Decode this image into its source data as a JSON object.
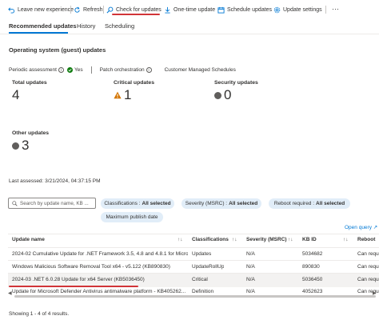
{
  "toolbar": {
    "leave": "Leave new experience",
    "refresh": "Refresh",
    "check": "Check for updates",
    "onetime": "One-time update",
    "schedule": "Schedule updates",
    "settings": "Update settings",
    "more": "···"
  },
  "tabs": [
    "Recommended updates",
    "History",
    "Scheduling"
  ],
  "section_title": "Operating system (guest) updates",
  "status": {
    "periodic_label": "Periodic assessment",
    "periodic_value": "Yes",
    "patch_label": "Patch orchestration",
    "customer": "Customer Managed Schedules"
  },
  "cards": {
    "total": {
      "label": "Total updates",
      "value": "4"
    },
    "critical": {
      "label": "Critical updates",
      "value": "1"
    },
    "security": {
      "label": "Security updates",
      "value": "0"
    },
    "other": {
      "label": "Other updates",
      "value": "3"
    }
  },
  "last_assessed": "Last assessed: 3/21/2024, 04:37:15 PM",
  "search": {
    "placeholder": "Search by update name, KB ..."
  },
  "filters": [
    {
      "label": "Classifications :",
      "value": "All selected"
    },
    {
      "label": "Severity (MSRC) :",
      "value": "All selected"
    },
    {
      "label": "Reboot required :",
      "value": "All selected"
    },
    {
      "label": "Maximum publish date",
      "value": ""
    }
  ],
  "open_query": "Open query",
  "table": {
    "headers": [
      "Update name",
      "Classifications",
      "Severity (MSRC)",
      "KB ID",
      "Reboot"
    ],
    "rows": [
      [
        "2024-02 Cumulative Update for .NET Framework 3.5, 4.8 and 4.8.1 for Micro...",
        "Updates",
        "N/A",
        "5034682",
        "Can requ"
      ],
      [
        "Windows Malicious Software Removal Tool x64 - v5.122 (KB890830)",
        "UpdateRollUp",
        "N/A",
        "890830",
        "Can requ"
      ],
      [
        "2024-03 .NET 6.0.28 Update for x64 Server (KB5036450)",
        "Critical",
        "N/A",
        "5036450",
        "Can requ"
      ],
      [
        "Update for Microsoft Defender Antivirus antimalware platform - KB405262...",
        "Definition",
        "N/A",
        "4052623",
        "Can requ"
      ]
    ]
  },
  "footer": "Showing 1 - 4 of 4 results.",
  "colors": {
    "accent": "#0078d4",
    "annotation": "#d13438",
    "success": "#107c10",
    "warning": "#d47500"
  }
}
